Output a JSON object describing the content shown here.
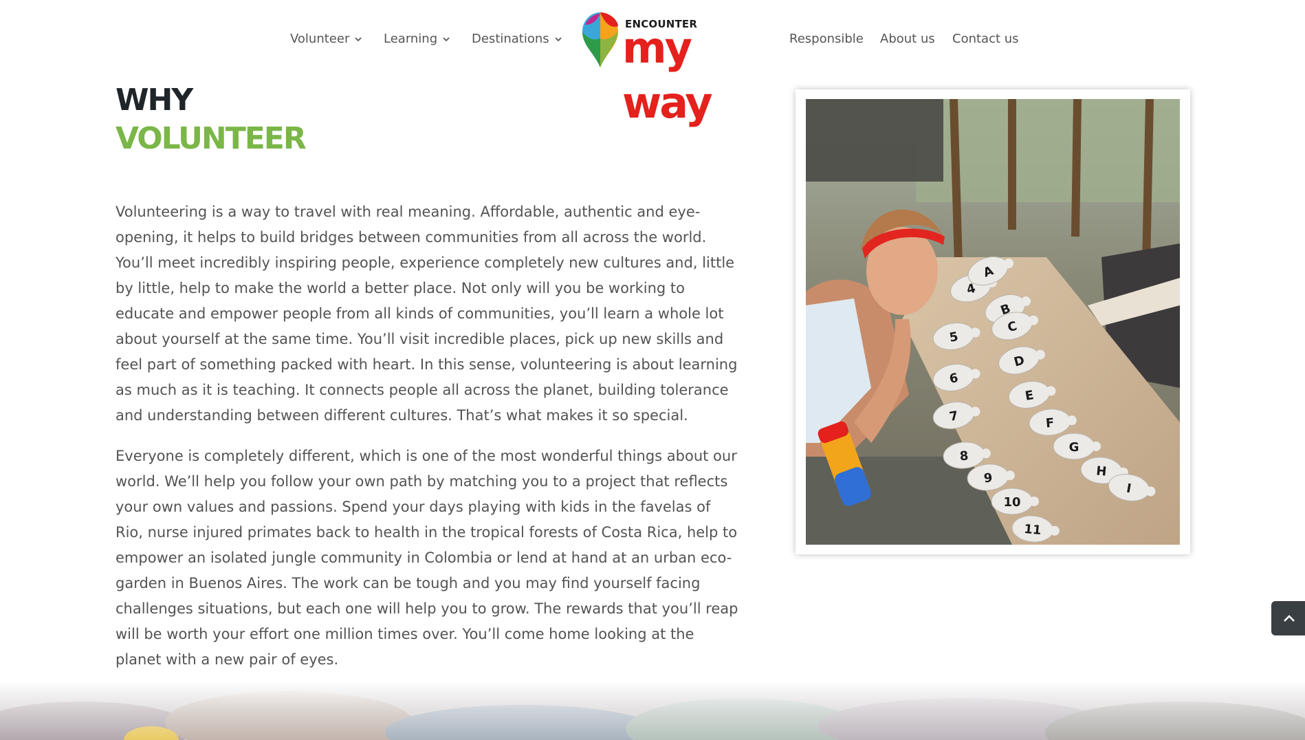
{
  "nav": {
    "items": [
      {
        "label": "Volunteer",
        "has_dropdown": true
      },
      {
        "label": "Learning",
        "has_dropdown": true
      },
      {
        "label": "Destinations",
        "has_dropdown": true
      },
      {
        "label": "Responsible",
        "has_dropdown": false
      },
      {
        "label": "About us",
        "has_dropdown": false
      },
      {
        "label": "Contact us",
        "has_dropdown": false
      }
    ],
    "chevron_icon": "chevron-down-icon"
  },
  "logo": {
    "small_text": "ENCOUNTER",
    "big_text": "my way",
    "mark_icon": "location-pin-icon",
    "brand_color": "#e4211d"
  },
  "section": {
    "heading_line1": "WHY",
    "heading_line2": "VOLUNTEER",
    "heading_color": "#1f2529",
    "accent_color": "#7ab648",
    "paragraphs": [
      "Volunteering is a way to travel with real meaning. Affordable, authentic and eye-opening, it helps to build bridges between communities from all across the world. You’ll meet incredibly inspiring people, experience completely new cultures and, little by little, help to make the world a better place. Not only will you be working to educate and empower people from all kinds of communities, you’ll learn a whole lot about yourself at the same time. You’ll visit incredible places, pick up new skills and feel part of something packed with heart. In this sense, volunteering is about learning as much as it is teaching. It connects people all across the planet, building tolerance and understanding between different cultures. That’s what makes it so special.",
      "Everyone is completely different, which is one of the most wonderful things about our world. We’ll help you follow your own path by matching you to a project that reflects your own values and passions. Spend your days playing with kids in the favelas of Rio, nurse injured primates back to health in the tropical forests of Costa Rica, help to empower an isolated jungle community in Colombia or lend at hand at an urban eco-garden in Buenos Aires. The work can be tough and you may find yourself facing challenges situations, but each one will help you to grow. The rewards that you’ll reap will be worth your effort one million times over. You’ll come home looking at the planet with a new pair of eyes."
    ]
  },
  "photo": {
    "turtle_labels": [
      "4",
      "5",
      "6",
      "7",
      "8",
      "9",
      "10",
      "11",
      "A",
      "B",
      "C",
      "D",
      "E",
      "F",
      "G",
      "H",
      "I"
    ]
  },
  "scroll_top": {
    "icon": "chevron-up-icon"
  }
}
